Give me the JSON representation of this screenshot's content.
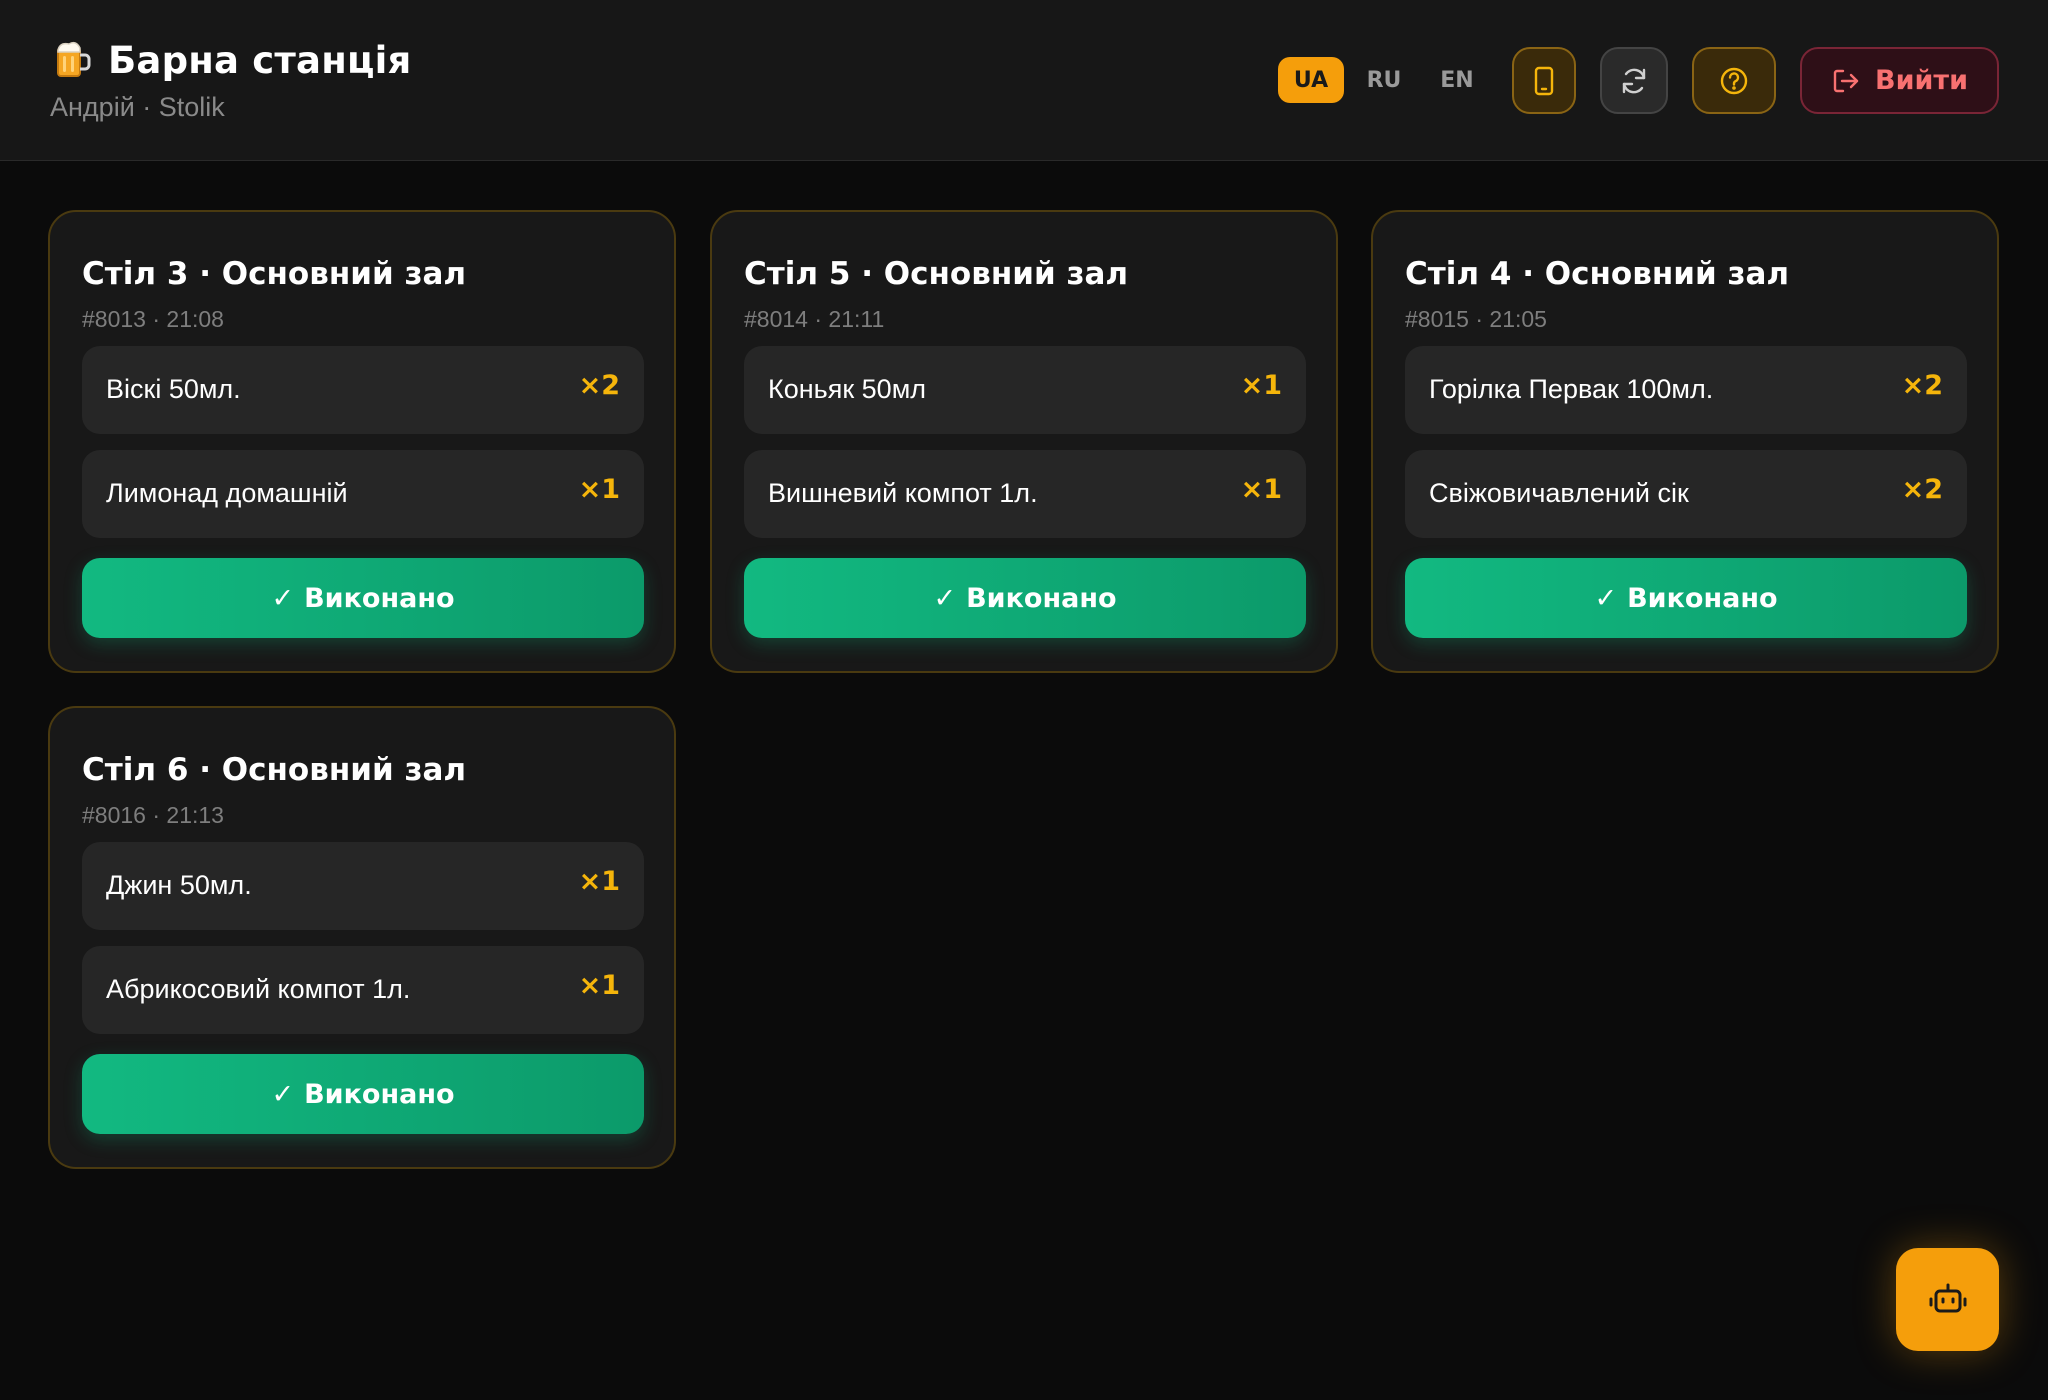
{
  "header": {
    "title": "Барна станція",
    "subtitle": "Андрій · Stolik",
    "languages": [
      {
        "code": "UA",
        "active": true
      },
      {
        "code": "RU",
        "active": false
      },
      {
        "code": "EN",
        "active": false
      }
    ],
    "logout_label": "Вийти"
  },
  "orders": [
    {
      "title": "Стіл 3 · Основний зал",
      "meta": "#8013 · 21:08",
      "items": [
        {
          "name": "Віскі 50мл.",
          "qty": "×2"
        },
        {
          "name": "Лимонад домашній",
          "qty": "×1"
        }
      ],
      "done_label": "Виконано",
      "done_check": "✓"
    },
    {
      "title": "Стіл 5 · Основний зал",
      "meta": "#8014 · 21:11",
      "items": [
        {
          "name": "Коньяк 50мл",
          "qty": "×1"
        },
        {
          "name": "Вишневий компот 1л.",
          "qty": "×1"
        }
      ],
      "done_label": "Виконано",
      "done_check": "✓"
    },
    {
      "title": "Стіл 4 · Основний зал",
      "meta": "#8015 · 21:05",
      "items": [
        {
          "name": "Горілка Первак 100мл.",
          "qty": "×2"
        },
        {
          "name": "Свіжовичавлений сік",
          "qty": "×2"
        }
      ],
      "done_label": "Виконано",
      "done_check": "✓"
    },
    {
      "title": "Стіл 6 · Основний зал",
      "meta": "#8016 · 21:13",
      "items": [
        {
          "name": "Джин 50мл.",
          "qty": "×1"
        },
        {
          "name": "Абрикосовий компот 1л.",
          "qty": "×1"
        }
      ],
      "done_label": "Виконано",
      "done_check": "✓"
    }
  ],
  "icons": {
    "brand": "beer-mug-icon",
    "phone": "phone-icon",
    "refresh": "refresh-icon",
    "help": "help-icon",
    "logout": "logout-icon",
    "assistant": "robot-icon"
  },
  "colors": {
    "accent": "#f59e0b",
    "success": "#10b981",
    "danger": "#f87171",
    "background": "#0b0b0b",
    "card": "#181818"
  }
}
